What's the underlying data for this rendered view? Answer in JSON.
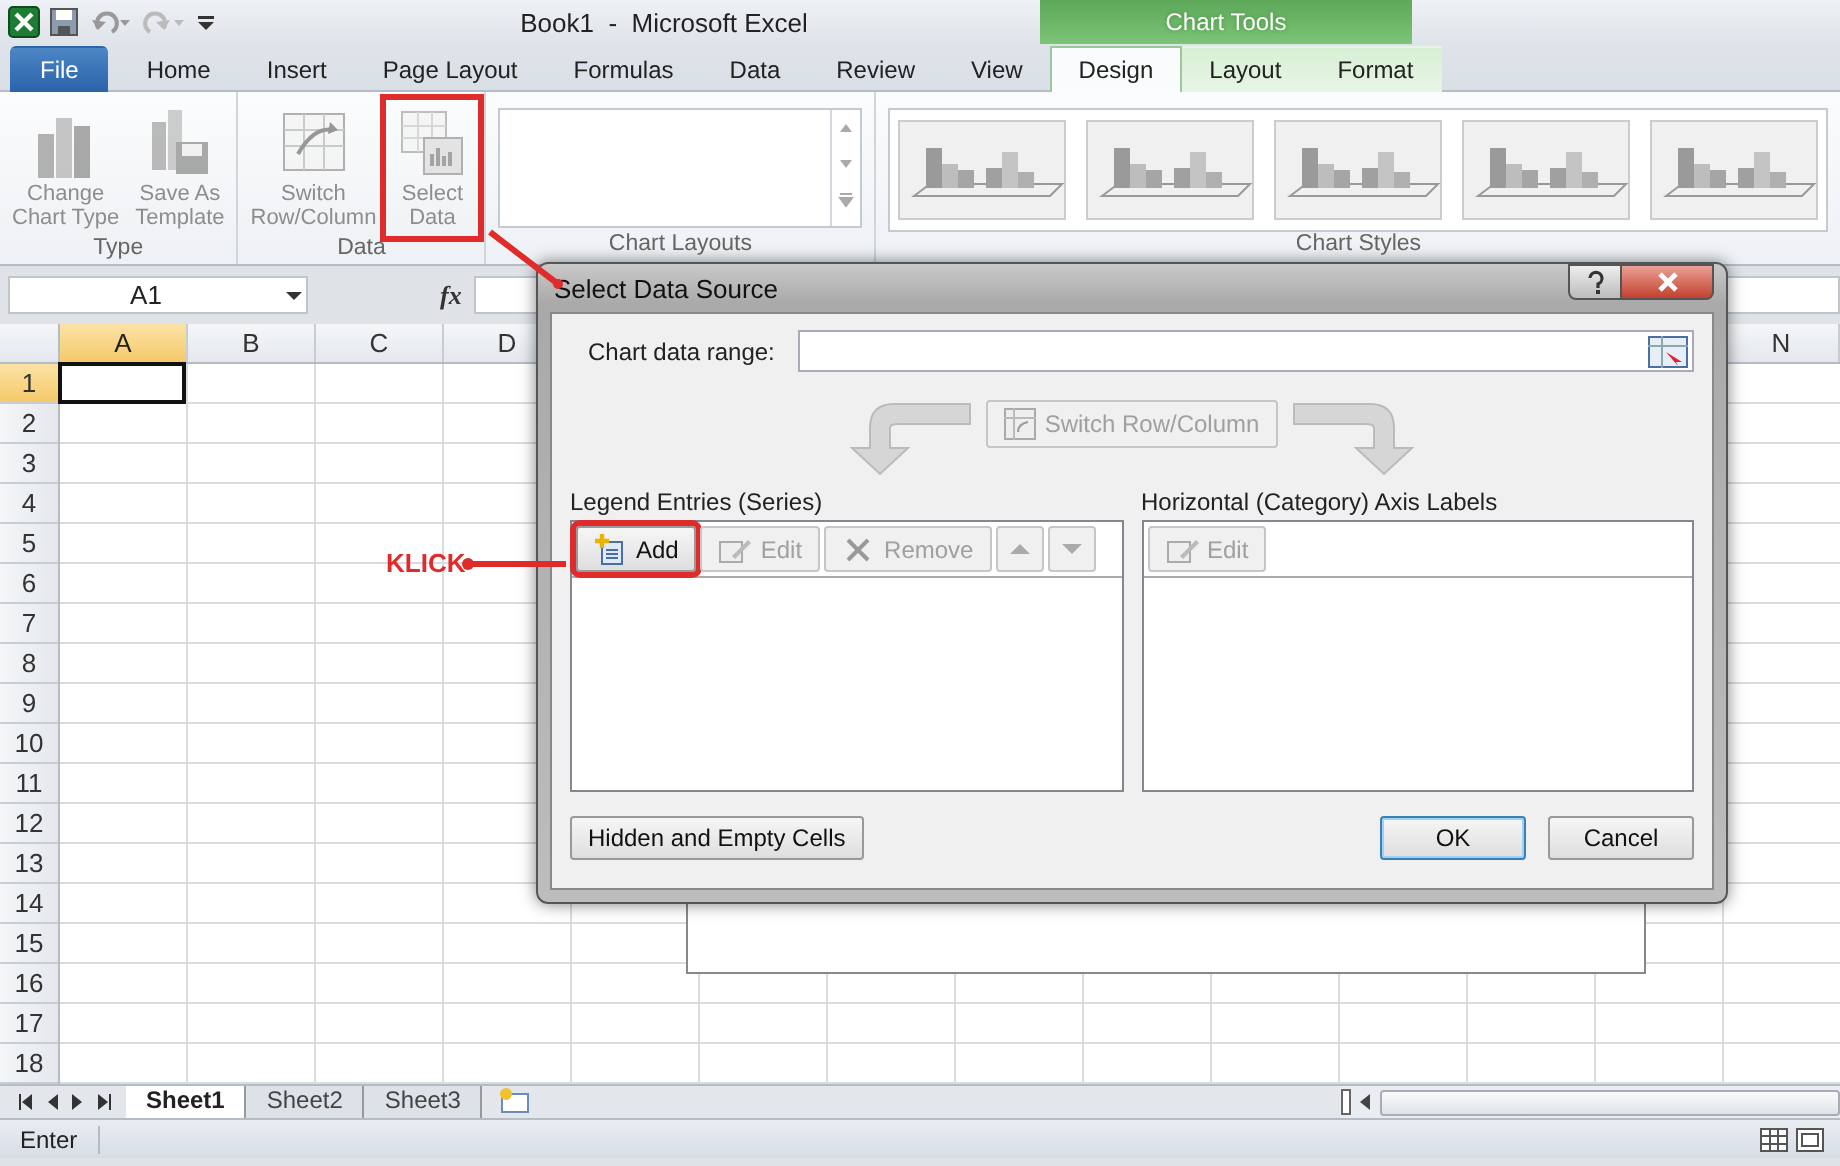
{
  "title_bar": {
    "title": "Book1  -  Microsoft Excel",
    "contextual_group": "Chart Tools"
  },
  "ribbon_tabs": [
    {
      "label": "File",
      "kind": "file",
      "selected": false
    },
    {
      "label": "Home",
      "kind": "normal",
      "selected": false
    },
    {
      "label": "Insert",
      "kind": "normal",
      "selected": false
    },
    {
      "label": "Page Layout",
      "kind": "normal",
      "selected": false
    },
    {
      "label": "Formulas",
      "kind": "normal",
      "selected": false
    },
    {
      "label": "Data",
      "kind": "normal",
      "selected": false
    },
    {
      "label": "Review",
      "kind": "normal",
      "selected": false
    },
    {
      "label": "View",
      "kind": "normal",
      "selected": false
    },
    {
      "label": "Design",
      "kind": "contextual",
      "selected": true
    },
    {
      "label": "Layout",
      "kind": "contextual",
      "selected": false
    },
    {
      "label": "Format",
      "kind": "contextual",
      "selected": false
    }
  ],
  "ribbon_groups": [
    {
      "label": "Type",
      "kind": "buttons",
      "buttons": [
        {
          "label": "Change\nChart Type",
          "kind": "chart",
          "disabled": true,
          "highlighted": false
        },
        {
          "label": "Save As\nTemplate",
          "kind": "template",
          "disabled": true,
          "highlighted": false
        }
      ]
    },
    {
      "label": "Data",
      "kind": "buttons",
      "buttons": [
        {
          "label": "Switch\nRow/Column",
          "kind": "switch",
          "disabled": true,
          "highlighted": false
        },
        {
          "label": "Select\nData",
          "kind": "select",
          "disabled": true,
          "highlighted": true
        }
      ]
    },
    {
      "label": "Chart Layouts",
      "kind": "gallery"
    },
    {
      "label": "Chart Styles",
      "kind": "styles",
      "items": [
        {
          "kind": "chart-style"
        },
        {
          "kind": "chart-style"
        },
        {
          "kind": "chart-style"
        },
        {
          "kind": "chart-style"
        },
        {
          "kind": "chart-style"
        }
      ]
    }
  ],
  "formula_bar": {
    "name_box": "A1",
    "function_label": "fx"
  },
  "grid": {
    "columns": [
      {
        "label": "A",
        "selected": true
      },
      {
        "label": "B",
        "selected": false
      },
      {
        "label": "C",
        "selected": false
      },
      {
        "label": "D",
        "selected": false
      },
      {
        "label": "N",
        "selected": false
      }
    ],
    "rows": [
      {
        "label": "1",
        "selected": true
      },
      {
        "label": "2",
        "selected": false
      },
      {
        "label": "3",
        "selected": false
      },
      {
        "label": "4",
        "selected": false
      },
      {
        "label": "5",
        "selected": false
      },
      {
        "label": "6",
        "selected": false
      },
      {
        "label": "7",
        "selected": false
      },
      {
        "label": "8",
        "selected": false
      },
      {
        "label": "9",
        "selected": false
      },
      {
        "label": "10",
        "selected": false
      },
      {
        "label": "11",
        "selected": false
      },
      {
        "label": "12",
        "selected": false
      },
      {
        "label": "13",
        "selected": false
      },
      {
        "label": "14",
        "selected": false
      },
      {
        "label": "15",
        "selected": false
      },
      {
        "label": "16",
        "selected": false
      },
      {
        "label": "17",
        "selected": false
      },
      {
        "label": "18",
        "selected": false
      }
    ]
  },
  "sheet_tabs": [
    {
      "label": "Sheet1",
      "selected": true
    },
    {
      "label": "Sheet2",
      "selected": false
    },
    {
      "label": "Sheet3",
      "selected": false
    }
  ],
  "status_bar": {
    "mode": "Enter"
  },
  "dialog": {
    "title": "Select Data Source",
    "range_label": "Chart data range:",
    "switch_button": {
      "label": "Switch Row/Column",
      "disabled": true
    },
    "series_panel": {
      "title": "Legend Entries (Series)",
      "buttons": [
        {
          "label": "Add",
          "kind": "add",
          "disabled": false,
          "highlighted": true
        },
        {
          "label": "Edit",
          "kind": "edit",
          "disabled": true,
          "highlighted": false
        },
        {
          "label": "Remove",
          "kind": "remove",
          "disabled": true,
          "highlighted": false
        },
        {
          "kind": "up",
          "disabled": true,
          "highlighted": false
        },
        {
          "kind": "down",
          "disabled": true,
          "highlighted": false
        }
      ]
    },
    "axis_panel": {
      "title": "Horizontal (Category) Axis Labels",
      "buttons": [
        {
          "label": "Edit",
          "kind": "edit",
          "disabled": true,
          "highlighted": false
        }
      ]
    },
    "footer_buttons": [
      {
        "label": "Hidden and Empty Cells",
        "default": false
      },
      {
        "label": "OK",
        "default": true
      },
      {
        "label": "Cancel",
        "default": false
      }
    ]
  },
  "callout": {
    "label": "KLICK"
  }
}
